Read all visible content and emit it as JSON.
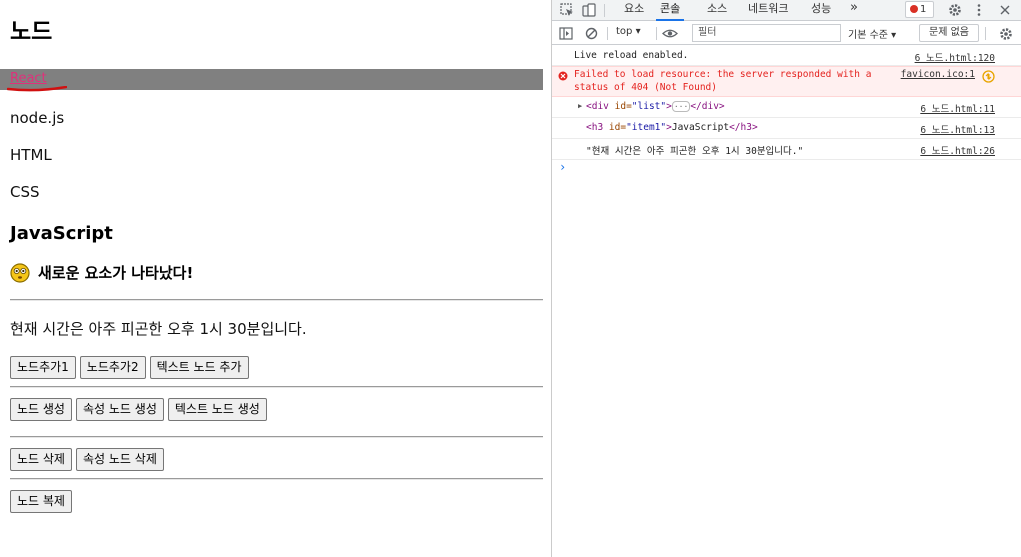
{
  "page": {
    "title": "노드",
    "list_items": [
      "React",
      "node.js",
      "HTML",
      "CSS"
    ],
    "heading_js": "JavaScript",
    "new_element": "새로운 요소가 나타났다!",
    "time_text": "현재 시간은 아주 피곤한 오후 1시 30분입니다.",
    "buttons_row1": [
      "노드추가1",
      "노드추가2",
      "텍스트 노드 추가"
    ],
    "buttons_row2": [
      "노드 생성",
      "속성 노드 생성",
      "텍스트 노드 생성"
    ],
    "buttons_row3": [
      "노드 삭제",
      "속성 노드 삭제"
    ],
    "buttons_row4": [
      "노드 복제"
    ],
    "highlight_color": "#808080",
    "react_text_color": "#e0307a"
  },
  "devtools": {
    "tabs": [
      "요소",
      "콘솔",
      "소스",
      "네트워크",
      "성능"
    ],
    "active_tab": "콘솔",
    "more_tabs": "»",
    "error_count": "1",
    "context": "top",
    "filter_placeholder": "필터",
    "level": "기본 수준",
    "issues": "문제 없음",
    "logs": [
      {
        "text": "Live reload enabled.",
        "source": "6 노드.html:120"
      },
      {
        "text_line1": "Failed to load resource: the server responded with a",
        "text_line2": "status of 404 (Not Found)",
        "source": "favicon.ico:1"
      },
      {
        "tag_open": "<div",
        "attr_name": "id=",
        "attr_value": "\"list\"",
        "tag_close": ">",
        "ellipsis": "···",
        "end_tag": "</div>",
        "source": "6 노드.html:11"
      },
      {
        "tag_open": "<h3",
        "attr_name": "id=",
        "attr_value": "\"item1\"",
        "tag_close": ">",
        "content": "JavaScript",
        "end_tag": "</h3>",
        "source": "6 노드.html:13"
      },
      {
        "text": "\"현재 시간은 아주 피곤한 오후 1시 30분입니다.\"",
        "source": "6 노드.html:26"
      }
    ],
    "prompt": "›",
    "error_color": "#e4231f",
    "accent_color": "#1a73e8"
  }
}
